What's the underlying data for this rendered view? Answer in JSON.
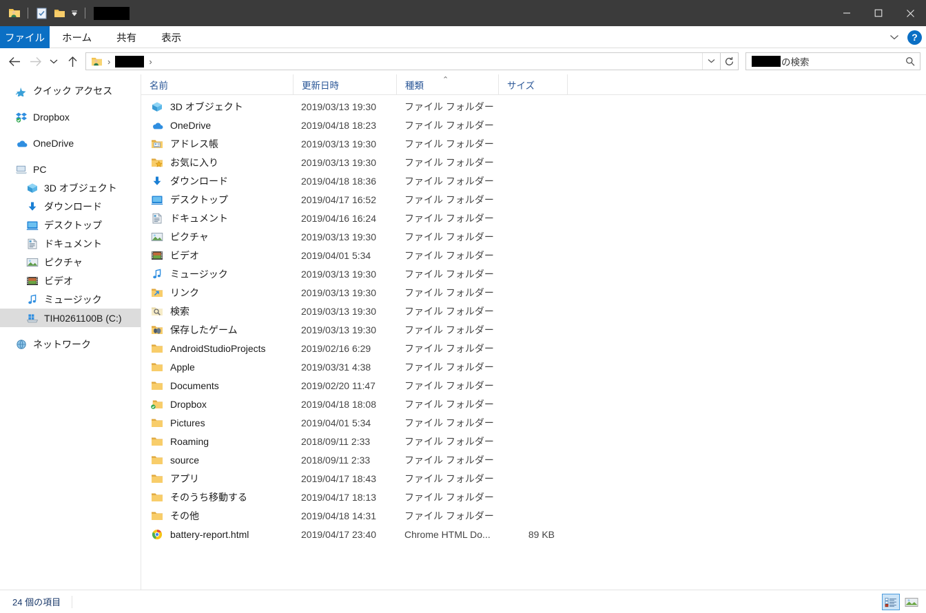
{
  "window": {
    "title_redacted": true,
    "quick_access": [
      {
        "name": "user-folder-icon",
        "label": "ユーザーフォルダー"
      },
      {
        "name": "properties-icon",
        "label": "プロパティ"
      },
      {
        "name": "new-folder-icon",
        "label": "新しいフォルダー"
      },
      {
        "name": "customize-qat-dropdown",
        "label": "クイック アクセス ツール バーのユーザー設定"
      }
    ],
    "controls": {
      "minimize": "─",
      "maximize": "□",
      "close": "✕"
    }
  },
  "ribbon": {
    "tabs": [
      {
        "label": "ファイル",
        "active": true
      },
      {
        "label": "ホーム",
        "active": false
      },
      {
        "label": "共有",
        "active": false
      },
      {
        "label": "表示",
        "active": false
      }
    ],
    "collapse_icon": "chevron-down-icon",
    "help_label": "?"
  },
  "navigation": {
    "back": "←",
    "forward": "→",
    "recent": "⌄",
    "up": "↑",
    "breadcrumb": {
      "root_icon": "user-folder-icon",
      "separator": "›",
      "redacted_segment": true
    },
    "dropdown_icon": "chevron-down-icon",
    "refresh_icon": "refresh-icon"
  },
  "search": {
    "suffix_text": "の検索",
    "redacted_prefix": true,
    "icon": "search-icon"
  },
  "sidebar": {
    "items": [
      {
        "label": "クイック アクセス",
        "icon": "quick-access-star-icon",
        "indent": false,
        "selected": false,
        "gap_after": true
      },
      {
        "label": "Dropbox",
        "icon": "dropbox-icon",
        "indent": false,
        "selected": false,
        "gap_after": true
      },
      {
        "label": "OneDrive",
        "icon": "onedrive-cloud-icon",
        "indent": false,
        "selected": false,
        "gap_after": true
      },
      {
        "label": "PC",
        "icon": "pc-monitor-icon",
        "indent": false,
        "selected": false,
        "gap_after": false
      },
      {
        "label": "3D オブジェクト",
        "icon": "3d-object-icon",
        "indent": true,
        "selected": false,
        "gap_after": false
      },
      {
        "label": "ダウンロード",
        "icon": "downloads-arrow-icon",
        "indent": true,
        "selected": false,
        "gap_after": false
      },
      {
        "label": "デスクトップ",
        "icon": "desktop-icon",
        "indent": true,
        "selected": false,
        "gap_after": false
      },
      {
        "label": "ドキュメント",
        "icon": "documents-icon",
        "indent": true,
        "selected": false,
        "gap_after": false
      },
      {
        "label": "ピクチャ",
        "icon": "pictures-icon",
        "indent": true,
        "selected": false,
        "gap_after": false
      },
      {
        "label": "ビデオ",
        "icon": "videos-icon",
        "indent": true,
        "selected": false,
        "gap_after": false
      },
      {
        "label": "ミュージック",
        "icon": "music-note-icon",
        "indent": true,
        "selected": false,
        "gap_after": false
      },
      {
        "label": "TIH0261100B (C:)",
        "icon": "local-disk-icon",
        "indent": true,
        "selected": true,
        "gap_after": true
      },
      {
        "label": "ネットワーク",
        "icon": "network-icon",
        "indent": false,
        "selected": false,
        "gap_after": false
      }
    ]
  },
  "columns": {
    "name": "名前",
    "date": "更新日時",
    "type": "種類",
    "size": "サイズ",
    "sort_column": "type",
    "sort_direction_glyph": "⌃"
  },
  "files": [
    {
      "name": "3D オブジェクト",
      "date": "2019/03/13 19:30",
      "type": "ファイル フォルダー",
      "size": "",
      "icon": "3d-object-icon"
    },
    {
      "name": "OneDrive",
      "date": "2019/04/18 18:23",
      "type": "ファイル フォルダー",
      "size": "",
      "icon": "onedrive-cloud-icon"
    },
    {
      "name": "アドレス帳",
      "date": "2019/03/13 19:30",
      "type": "ファイル フォルダー",
      "size": "",
      "icon": "contacts-folder-icon"
    },
    {
      "name": "お気に入り",
      "date": "2019/03/13 19:30",
      "type": "ファイル フォルダー",
      "size": "",
      "icon": "favorites-folder-icon"
    },
    {
      "name": "ダウンロード",
      "date": "2019/04/18 18:36",
      "type": "ファイル フォルダー",
      "size": "",
      "icon": "downloads-arrow-icon"
    },
    {
      "name": "デスクトップ",
      "date": "2019/04/17 16:52",
      "type": "ファイル フォルダー",
      "size": "",
      "icon": "desktop-icon"
    },
    {
      "name": "ドキュメント",
      "date": "2019/04/16 16:24",
      "type": "ファイル フォルダー",
      "size": "",
      "icon": "documents-icon"
    },
    {
      "name": "ピクチャ",
      "date": "2019/03/13 19:30",
      "type": "ファイル フォルダー",
      "size": "",
      "icon": "pictures-icon"
    },
    {
      "name": "ビデオ",
      "date": "2019/04/01 5:34",
      "type": "ファイル フォルダー",
      "size": "",
      "icon": "videos-icon"
    },
    {
      "name": "ミュージック",
      "date": "2019/03/13 19:30",
      "type": "ファイル フォルダー",
      "size": "",
      "icon": "music-note-icon"
    },
    {
      "name": "リンク",
      "date": "2019/03/13 19:30",
      "type": "ファイル フォルダー",
      "size": "",
      "icon": "links-folder-icon"
    },
    {
      "name": "検索",
      "date": "2019/03/13 19:30",
      "type": "ファイル フォルダー",
      "size": "",
      "icon": "searches-folder-icon"
    },
    {
      "name": "保存したゲーム",
      "date": "2019/03/13 19:30",
      "type": "ファイル フォルダー",
      "size": "",
      "icon": "saved-games-folder-icon"
    },
    {
      "name": "AndroidStudioProjects",
      "date": "2019/02/16 6:29",
      "type": "ファイル フォルダー",
      "size": "",
      "icon": "folder-icon"
    },
    {
      "name": "Apple",
      "date": "2019/03/31 4:38",
      "type": "ファイル フォルダー",
      "size": "",
      "icon": "folder-icon"
    },
    {
      "name": "Documents",
      "date": "2019/02/20 11:47",
      "type": "ファイル フォルダー",
      "size": "",
      "icon": "folder-icon"
    },
    {
      "name": "Dropbox",
      "date": "2019/04/18 18:08",
      "type": "ファイル フォルダー",
      "size": "",
      "icon": "dropbox-synced-folder-icon"
    },
    {
      "name": "Pictures",
      "date": "2019/04/01 5:34",
      "type": "ファイル フォルダー",
      "size": "",
      "icon": "folder-icon"
    },
    {
      "name": "Roaming",
      "date": "2018/09/11 2:33",
      "type": "ファイル フォルダー",
      "size": "",
      "icon": "folder-icon"
    },
    {
      "name": "source",
      "date": "2018/09/11 2:33",
      "type": "ファイル フォルダー",
      "size": "",
      "icon": "folder-icon"
    },
    {
      "name": "アプリ",
      "date": "2019/04/17 18:43",
      "type": "ファイル フォルダー",
      "size": "",
      "icon": "folder-icon"
    },
    {
      "name": "そのうち移動する",
      "date": "2019/04/17 18:13",
      "type": "ファイル フォルダー",
      "size": "",
      "icon": "folder-icon"
    },
    {
      "name": "その他",
      "date": "2019/04/18 14:31",
      "type": "ファイル フォルダー",
      "size": "",
      "icon": "folder-icon"
    },
    {
      "name": "battery-report.html",
      "date": "2019/04/17 23:40",
      "type": "Chrome HTML Do...",
      "size": "89 KB",
      "icon": "chrome-icon"
    }
  ],
  "status": {
    "item_count_text": "24 個の項目",
    "view_details_label": "詳細表示",
    "view_large_icons_label": "大アイコン"
  },
  "colors": {
    "titlebar": "#3b3b3b",
    "accent": "#0b6fc4",
    "selection": "#dcdcdc",
    "header_text": "#2b5797",
    "folder": "#f8cd6a"
  }
}
